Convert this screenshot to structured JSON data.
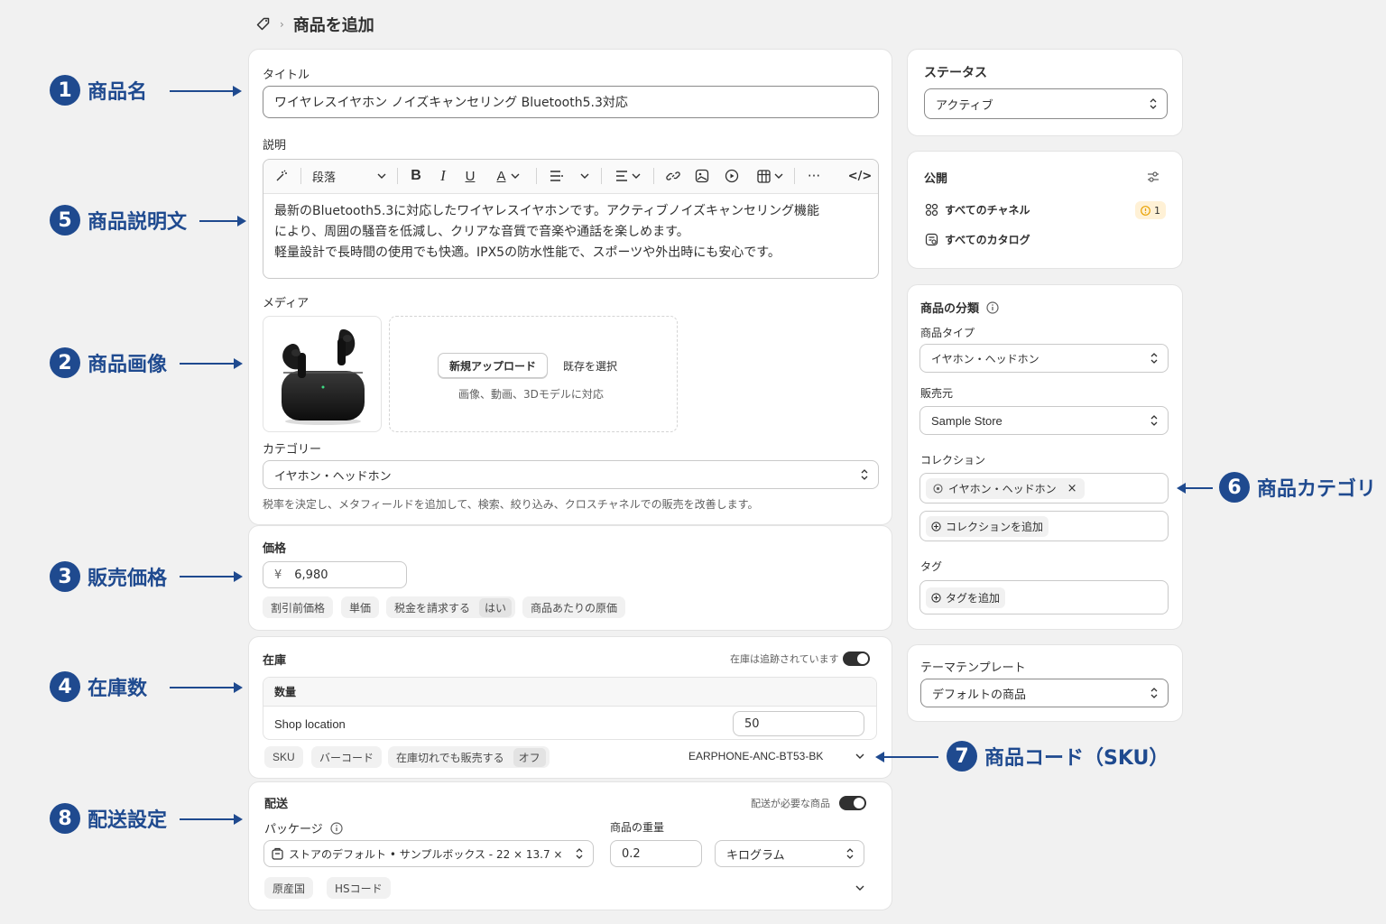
{
  "breadcrumb": {
    "icon": "tag-icon",
    "title": "商品を追加"
  },
  "title_section": {
    "label": "タイトル",
    "value": "ワイヤレスイヤホン ノイズキャンセリング Bluetooth5.3対応"
  },
  "description": {
    "label": "説明",
    "toolbar": {
      "paragraph": "段落",
      "bold": "B",
      "italic": "I",
      "underline": "U",
      "color": "A",
      "more": "···",
      "code": "</>"
    },
    "lines": [
      "最新のBluetooth5.3に対応したワイヤレスイヤホンです。アクティブノイズキャンセリング機能",
      "により、周囲の騒音を低減し、クリアな音質で音楽や通話を楽しめます。",
      "軽量設計で長時間の使用でも快適。IPX5の防水性能で、スポーツや外出時にも安心です。"
    ]
  },
  "media": {
    "label": "メディア",
    "upload_button": "新規アップロード",
    "select_existing": "既存を選択",
    "hint": "画像、動画、3Dモデルに対応"
  },
  "category": {
    "label": "カテゴリー",
    "value": "イヤホン・ヘッドホン",
    "hint": "税率を決定し、メタフィールドを追加して、検索、絞り込み、クロスチャネルでの販売を改善します。"
  },
  "price": {
    "label": "価格",
    "currency": "¥",
    "value": "6,980",
    "pills": {
      "compare": "割引前価格",
      "unit": "単価",
      "tax": "税金を請求する",
      "tax_value": "はい",
      "cost": "商品あたりの原価"
    }
  },
  "inventory": {
    "label": "在庫",
    "tracked_label": "在庫は追跡されています",
    "tracked": true,
    "quantity_header": "数量",
    "location": "Shop location",
    "quantity": "50",
    "pills": {
      "sku": "SKU",
      "barcode": "バーコード",
      "oversell": "在庫切れでも販売する",
      "oversell_value": "オフ"
    },
    "sku_value": "EARPHONE-ANC-BT53-BK"
  },
  "shipping": {
    "label": "配送",
    "required_label": "配送が必要な商品",
    "required": true,
    "package_label": "パッケージ",
    "package_value": "ストアのデフォルト • サンプルボックス - 22 × 13.7 ×",
    "weight_label": "商品の重量",
    "weight_value": "0.2",
    "weight_unit": "キログラム",
    "pills": {
      "origin": "原産国",
      "hs": "HSコード"
    }
  },
  "status": {
    "label": "ステータス",
    "value": "アクティブ"
  },
  "publishing": {
    "label": "公開",
    "channels": "すべてのチャネル",
    "channels_badge": "1",
    "catalogs": "すべてのカタログ"
  },
  "organization": {
    "label": "商品の分類",
    "type_label": "商品タイプ",
    "type_value": "イヤホン・ヘッドホン",
    "vendor_label": "販売元",
    "vendor_value": "Sample Store",
    "collection_label": "コレクション",
    "collection_tag": "イヤホン・ヘッドホン",
    "add_collection": "コレクションを追加",
    "tags_label": "タグ",
    "add_tag": "タグを追加"
  },
  "theme": {
    "label": "テーマテンプレート",
    "value": "デフォルトの商品"
  },
  "annotations": [
    {
      "num": "1",
      "text": "商品名"
    },
    {
      "num": "5",
      "text": "商品説明文"
    },
    {
      "num": "2",
      "text": "商品画像"
    },
    {
      "num": "3",
      "text": "販売価格"
    },
    {
      "num": "4",
      "text": "在庫数"
    },
    {
      "num": "8",
      "text": "配送設定"
    },
    {
      "num": "6",
      "text": "商品カテゴリ"
    },
    {
      "num": "7",
      "text": "商品コード（SKU）"
    }
  ],
  "colors": {
    "annotation": "#1f4a8f",
    "background": "#f1f1f1",
    "warning": "#e8a100"
  }
}
